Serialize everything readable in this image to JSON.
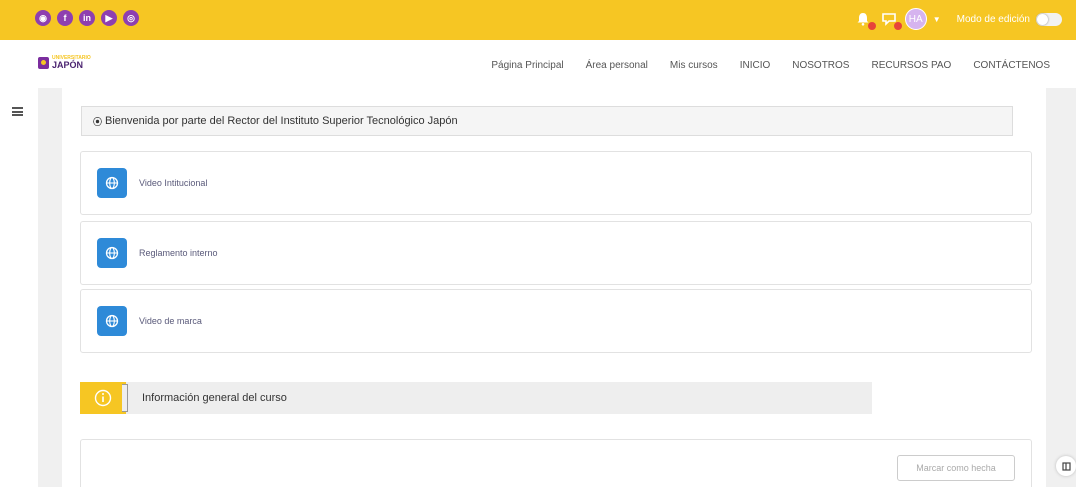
{
  "social_icons": [
    {
      "name": "web",
      "glyph": "◉"
    },
    {
      "name": "facebook",
      "glyph": "f"
    },
    {
      "name": "linkedin",
      "glyph": "in"
    },
    {
      "name": "youtube",
      "glyph": "▶"
    },
    {
      "name": "instagram",
      "glyph": "◎"
    }
  ],
  "topbar": {
    "avatar_initials": "HA",
    "edit_mode_label": "Modo de edición",
    "edit_mode_on": false
  },
  "logo": {
    "top": "UNIVERSITARIO",
    "bottom": "JAPÓN"
  },
  "nav": [
    "Página Principal",
    "Área personal",
    "Mis cursos",
    "INICIO",
    "NOSOTROS",
    "RECURSOS PAO",
    "CONTÁCTENOS"
  ],
  "welcome": {
    "bullet": "⦿",
    "text": "Bienvenida por parte del Rector del Instituto Superior Tecnológico Japón"
  },
  "activities": [
    {
      "label": "Video Intitucional"
    },
    {
      "label": "Reglamento interno"
    },
    {
      "label": "Video de marca"
    }
  ],
  "info_section": {
    "label": "Información general del curso"
  },
  "mark_done": {
    "label": "Marcar como hecha"
  },
  "colors": {
    "accent": "#f6c623",
    "brand_purple": "#7b2d9e",
    "activity_blue": "#2e8ad8"
  }
}
